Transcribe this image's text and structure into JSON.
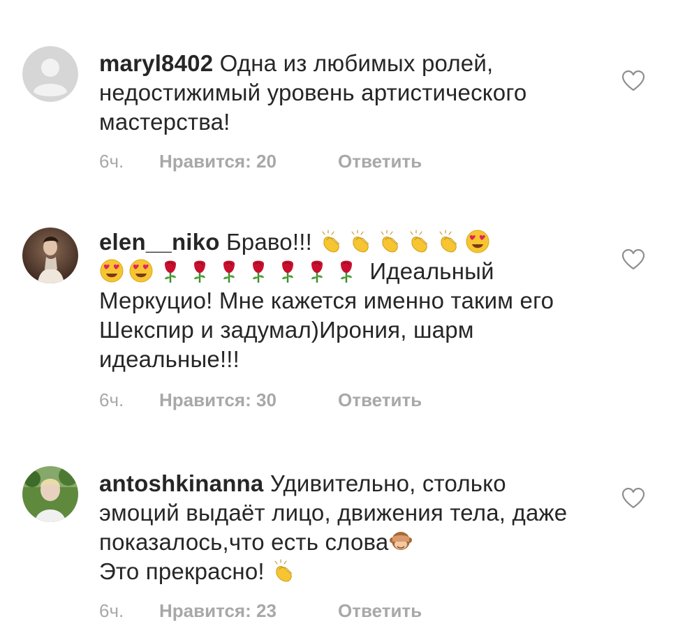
{
  "comments": [
    {
      "username": "maryl8402",
      "text": "Одна из любимых ролей, недостижимый уровень артистического мастерства!",
      "time": "6ч.",
      "likes": "Нравится: 20",
      "reply": "Ответить",
      "avatar": "default-avatar-icon"
    },
    {
      "username": "elen__niko",
      "text_before": "Браво!!!",
      "emojis_line1": [
        "clapping-hands",
        "clapping-hands",
        "clapping-hands",
        "clapping-hands",
        "clapping-hands",
        "heart-eyes"
      ],
      "emojis_line2": [
        "heart-eyes",
        "heart-eyes",
        "rose",
        "rose",
        "rose",
        "rose",
        "rose",
        "rose",
        "rose"
      ],
      "text_after": "Идеальный Меркуцио! Мне кажется именно таким его Шекспир и задумал)Ирония, шарм идеальные!!!",
      "time": "6ч.",
      "likes": "Нравится: 30",
      "reply": "Ответить",
      "avatar": "photo-avatar"
    },
    {
      "username": "antoshkinanna",
      "text_before": "Удивительно, столько эмоций выдаёт лицо, движения тела, даже показалось,что есть слова",
      "emoji_mid": "see-no-evil-monkey",
      "text_after": "Это прекрасно!",
      "emoji_end": "clapping-hands",
      "time": "6ч.",
      "likes": "Нравится: 23",
      "reply": "Ответить",
      "avatar": "photo-avatar"
    }
  ],
  "colors": {
    "text": "#262626",
    "meta": "#a8a8a8",
    "heart_outline": "#8e8e8e"
  }
}
